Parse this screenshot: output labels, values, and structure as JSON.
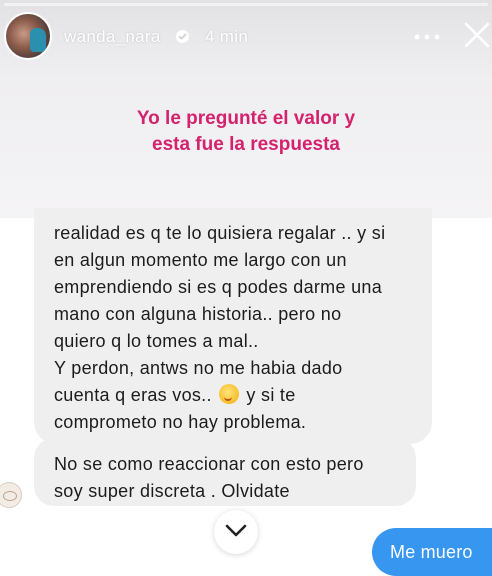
{
  "story": {
    "username": "wanda_nara",
    "time": "4 min",
    "caption_line1": "Yo le pregunté el valor y",
    "caption_line2": "esta fue la respuesta"
  },
  "chat": {
    "received_1": [
      "realidad es q te lo quisiera regalar .. y si",
      "en algun momento me largo con un",
      "emprendiendo si es q podes darme una",
      "mano con alguna historia.. pero no",
      "quiero q lo tomes  a mal..",
      "Y perdon, antws no me habia dado",
      "cuenta q eras vos..",
      "y si te",
      "comprometo no hay problema."
    ],
    "received_2": [
      "No se como  reaccionar con esto pero",
      "soy super discreta . Olvidate"
    ],
    "sent": "Me muero"
  },
  "colors": {
    "caption": "#d4226d",
    "received_bubble": "#efefef",
    "sent_bubble": "#3797f0"
  },
  "icons": {
    "verified": "verified-badge-icon",
    "more": "more-dots-icon",
    "close": "close-icon",
    "scroll": "chevron-down-icon",
    "emoji": "winking-face-emoji"
  }
}
